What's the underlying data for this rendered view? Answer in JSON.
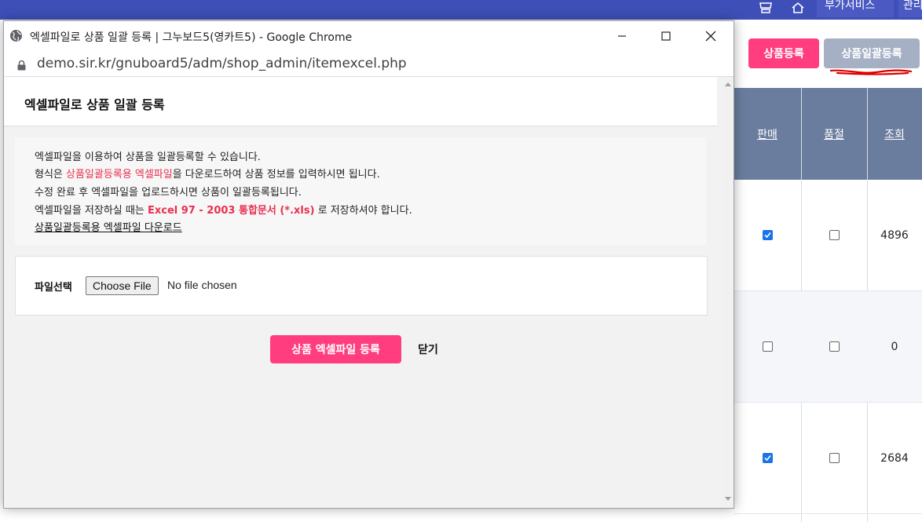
{
  "background": {
    "top_buttons": [
      "부가서비스",
      "관리"
    ],
    "header_buttons": {
      "register": "상품등록",
      "bulk_register": "상품일괄등록"
    },
    "table": {
      "columns": [
        "판매",
        "품절",
        "조회"
      ],
      "rows": [
        {
          "sale": true,
          "soldout": false,
          "views": "4896"
        },
        {
          "sale": false,
          "soldout": false,
          "views": "0"
        },
        {
          "sale": true,
          "soldout": false,
          "views": "2684"
        }
      ]
    }
  },
  "popup": {
    "window_title": "엑셀파일로 상품 일괄 등록 | 그누보드5(영카트5) - Google Chrome",
    "url": "demo.sir.kr/gnuboard5/adm/shop_admin/itemexcel.php",
    "heading": "엑셀파일로 상품 일괄 등록",
    "info": {
      "line1": "엑셀파일을 이용하여 상품을 일괄등록할 수 있습니다.",
      "line2_prefix": "형식은 ",
      "line2_highlight": "상품일괄등록용 엑셀파일",
      "line2_suffix": "을 다운로드하여 상품 정보를 입력하시면 됩니다.",
      "line3": "수정 완료 후 엑셀파일을 업로드하시면 상품이 일괄등록됩니다.",
      "line4_prefix": "엑셀파일을 저장하실 때는 ",
      "line4_highlight": "Excel 97 - 2003 통합문서 (*.xls)",
      "line4_suffix": " 로 저장하셔야 합니다.",
      "download_link": "상품일괄등록용 엑셀파일 다운로드"
    },
    "file": {
      "label": "파일선택",
      "button": "Choose File",
      "status": "No file chosen"
    },
    "submit_label": "상품 엑셀파일 등록",
    "close_label": "닫기"
  }
}
